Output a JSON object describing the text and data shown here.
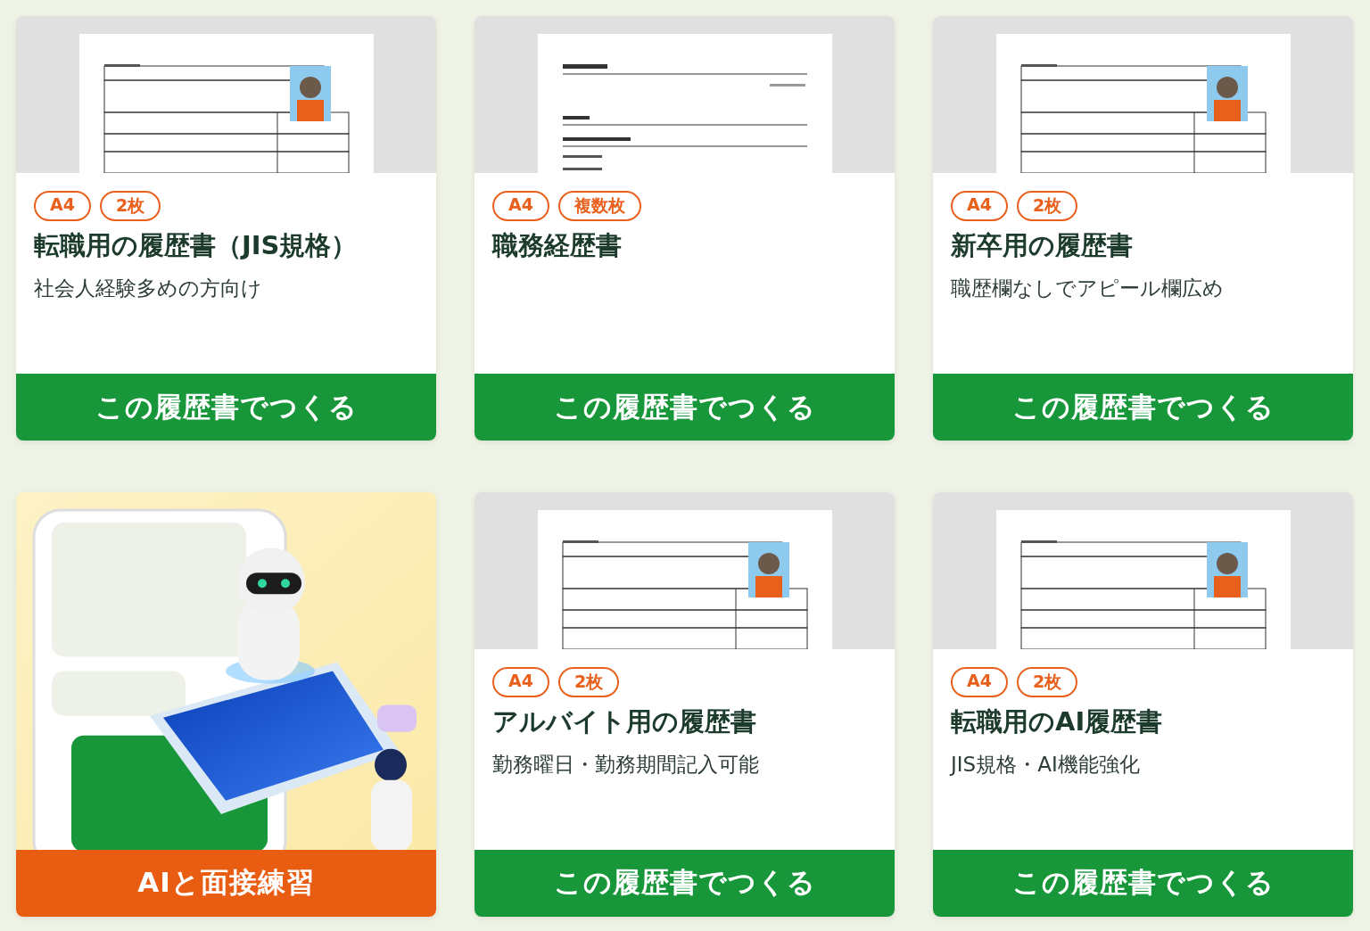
{
  "cards": [
    {
      "kind": "template",
      "preview": {
        "kind": "resume"
      },
      "tags": [
        "A4",
        "2枚"
      ],
      "title": "転職用の履歴書（JIS規格）",
      "subtitle": "社会人経験多めの方向け",
      "button": "この履歴書でつくる"
    },
    {
      "kind": "template",
      "preview": {
        "kind": "career"
      },
      "tags": [
        "A4",
        "複数枚"
      ],
      "title": "職務経歴書",
      "button": "この履歴書でつくる"
    },
    {
      "kind": "template",
      "preview": {
        "kind": "resume"
      },
      "tags": [
        "A4",
        "2枚"
      ],
      "title": "新卒用の履歴書",
      "subtitle": "職歴欄なしでアピール欄広め",
      "button": "この履歴書でつくる"
    },
    {
      "kind": "practice",
      "preview": {
        "kind": "illustration"
      },
      "button": "AIと面接練習"
    },
    {
      "kind": "template",
      "preview": {
        "kind": "resume"
      },
      "tags": [
        "A4",
        "2枚"
      ],
      "title": "アルバイト用の履歴書",
      "subtitle": "勤務曜日・勤務期間記入可能",
      "button": "この履歴書でつくる"
    },
    {
      "kind": "template",
      "preview": {
        "kind": "resume"
      },
      "tags": [
        "A4",
        "2枚"
      ],
      "title": "転職用のAI履歴書",
      "subtitle": "JIS規格・AI機能強化",
      "button": "この履歴書でつくる"
    }
  ]
}
